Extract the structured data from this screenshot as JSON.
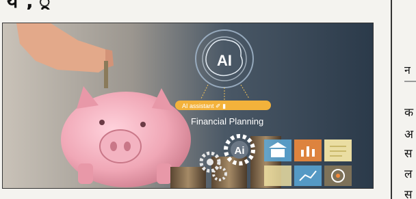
{
  "article": {
    "headline_fragment": "य ,  ू"
  },
  "photo": {
    "ai_badge_text": "AI",
    "assistant_bar_text": "AI assistant ✐  ▮",
    "financial_planning_text": "Financial Planning",
    "gear_ai_text": "Ai",
    "colors": {
      "sky_dark": "#2b3a4a",
      "piggy_pink": "#f0a7b6",
      "assistant_bar": "#f3b23b",
      "tile_orange": "#f08a3c",
      "tile_blue": "#5aa8d8",
      "tile_cream": "#f4e6a6"
    }
  },
  "side_column": {
    "heading_fragment": "न",
    "lines": [
      "क",
      "अ",
      "स",
      "ल",
      "स"
    ]
  }
}
